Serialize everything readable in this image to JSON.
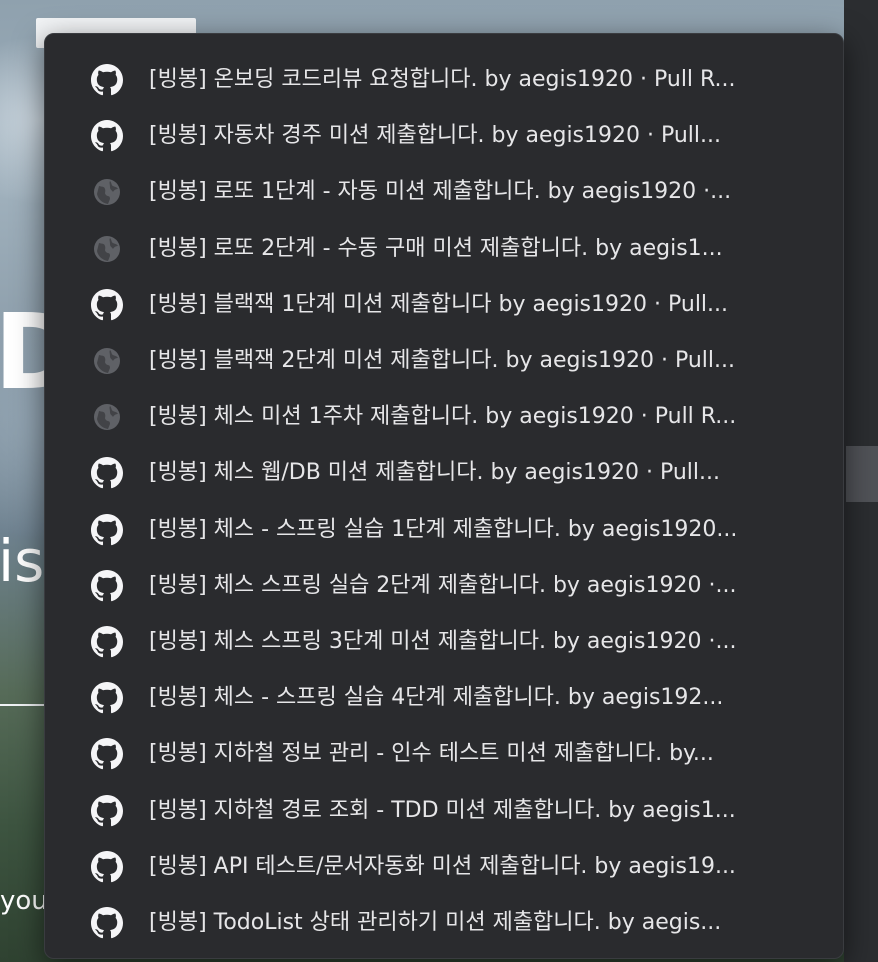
{
  "background": {
    "big_text": "Do",
    "mid_text": "is",
    "small_text": "you"
  },
  "history_menu": {
    "items": [
      {
        "icon": "github-icon",
        "title": "[빙봉] 온보딩 코드리뷰 요청합니다. by aegis1920 · Pull R..."
      },
      {
        "icon": "github-icon",
        "title": "[빙봉] 자동차 경주 미션 제출합니다. by aegis1920 · Pull..."
      },
      {
        "icon": "globe-icon",
        "title": "[빙봉] 로또 1단계 - 자동 미션 제출합니다. by aegis1920 ·..."
      },
      {
        "icon": "globe-icon",
        "title": "[빙봉] 로또 2단계 - 수동 구매 미션 제출합니다. by aegis1..."
      },
      {
        "icon": "github-icon",
        "title": "[빙봉] 블랙잭 1단계 미션 제출합니다 by aegis1920 · Pull..."
      },
      {
        "icon": "globe-icon",
        "title": "[빙봉] 블랙잭 2단계 미션 제출합니다. by aegis1920 · Pull..."
      },
      {
        "icon": "globe-icon",
        "title": "[빙봉] 체스 미션 1주차 제출합니다. by aegis1920 · Pull R..."
      },
      {
        "icon": "github-icon",
        "title": "[빙봉] 체스 웹/DB 미션 제출합니다. by aegis1920 · Pull..."
      },
      {
        "icon": "github-icon",
        "title": "[빙봉] 체스 - 스프링 실습 1단계 제출합니다. by aegis1920..."
      },
      {
        "icon": "github-icon",
        "title": "[빙봉] 체스 스프링 실습 2단계 제출합니다. by aegis1920 ·..."
      },
      {
        "icon": "github-icon",
        "title": "[빙봉] 체스 스프링 3단계 미션 제출합니다. by aegis1920 ·..."
      },
      {
        "icon": "github-icon",
        "title": "[빙봉] 체스 - 스프링 실습 4단계 제출합니다. by aegis192..."
      },
      {
        "icon": "github-icon",
        "title": "[빙봉] 지하철 정보 관리 - 인수 테스트 미션 제출합니다. by..."
      },
      {
        "icon": "github-icon",
        "title": "[빙봉] 지하철 경로 조회 - TDD 미션 제출합니다. by aegis1..."
      },
      {
        "icon": "github-icon",
        "title": "[빙봉] API 테스트/문서자동화 미션 제출합니다. by aegis19..."
      },
      {
        "icon": "github-icon",
        "title": "[빙봉] TodoList 상태 관리하기 미션 제출합니다. by aegis..."
      }
    ]
  },
  "colors": {
    "popup_bg": "#2a2b2e",
    "text": "#e6e6e8",
    "github_icon": "#f5f5f7",
    "globe_icon": "#5f6166"
  }
}
